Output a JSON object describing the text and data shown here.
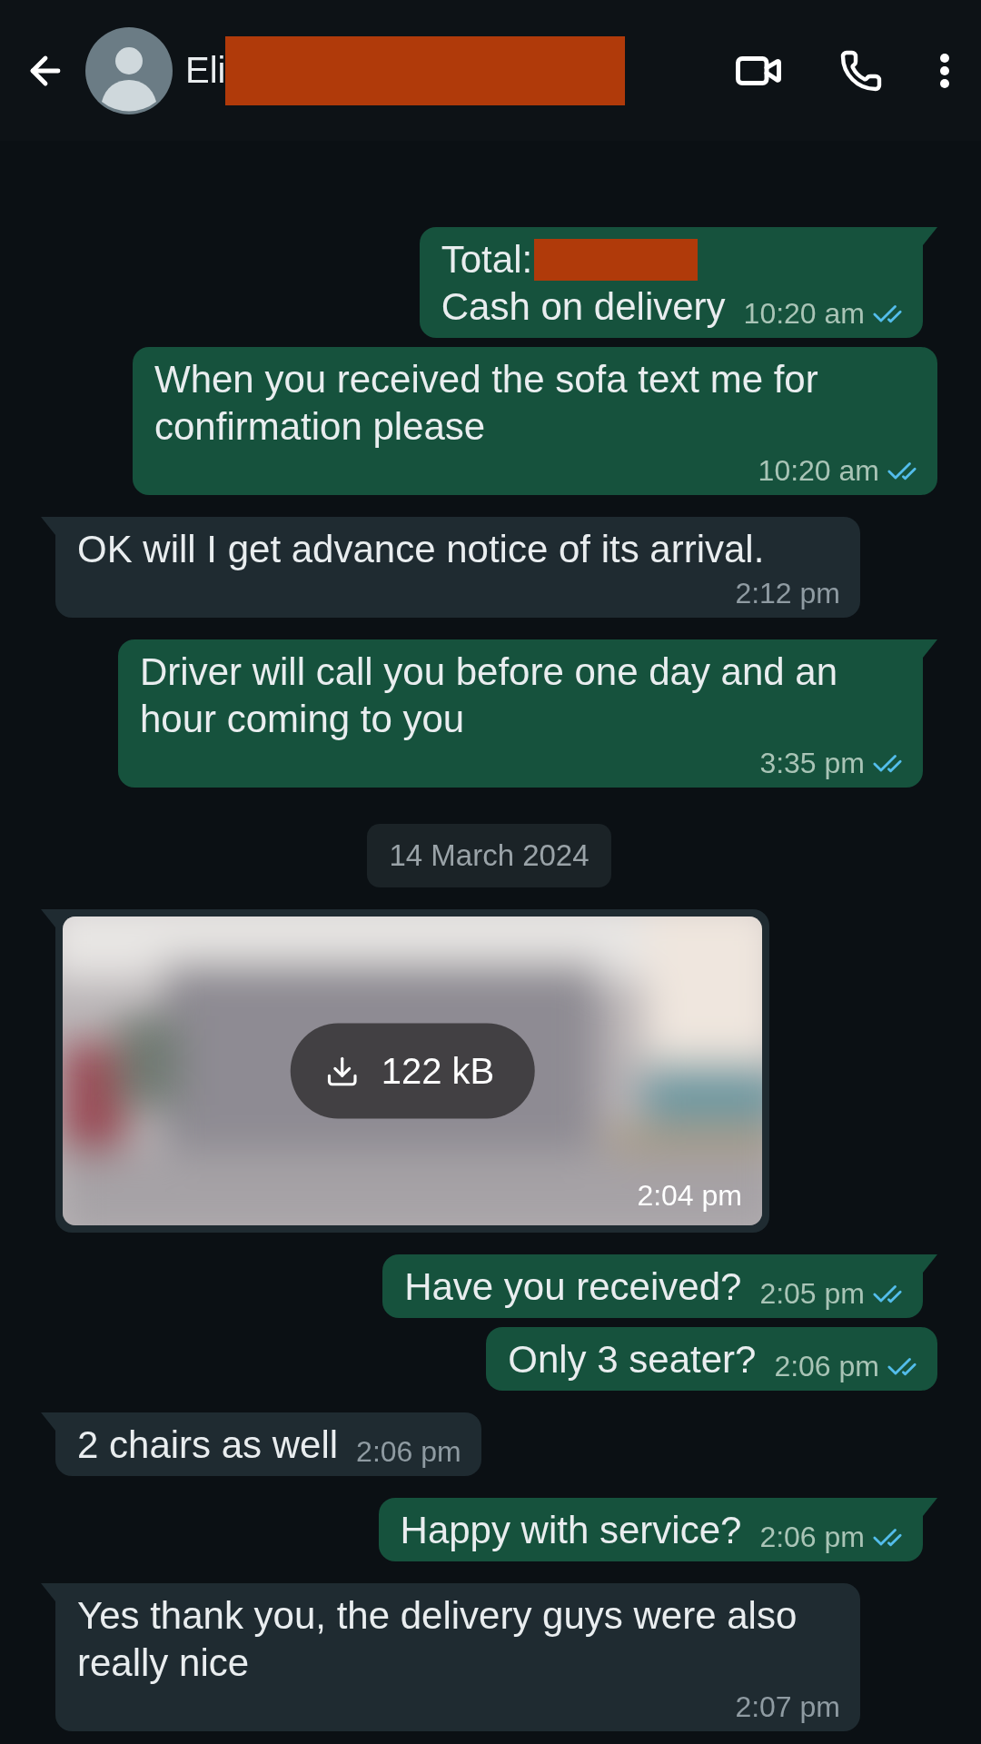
{
  "header": {
    "name": "Eli",
    "name_redacted": true
  },
  "messages": [
    {
      "kind": "text",
      "outgoing": true,
      "lines": [
        {
          "text": "Total:",
          "redacted": true
        },
        {
          "text": "Cash on delivery",
          "redacted": false
        }
      ],
      "time": "10:20 am",
      "read": true
    },
    {
      "kind": "text",
      "outgoing": true,
      "lines": [
        {
          "text": "When you received the sofa text me for confirmation please",
          "redacted": false
        }
      ],
      "time": "10:20 am",
      "read": true
    },
    {
      "kind": "text",
      "outgoing": false,
      "lines": [
        {
          "text": "OK  will I get advance notice of its arrival.",
          "redacted": false
        }
      ],
      "time": "2:12 pm"
    },
    {
      "kind": "text",
      "outgoing": true,
      "lines": [
        {
          "text": "Driver will call you before one day and an hour coming to you",
          "redacted": false
        }
      ],
      "time": "3:35 pm",
      "read": true
    },
    {
      "kind": "date",
      "text": "14 March 2024"
    },
    {
      "outgoing": false,
      "download": "122 kB",
      "time": "2:04 pm"
    },
    {
      "kind": "text",
      "outgoing": true,
      "lines": [
        {
          "text": "Have you received?",
          "redacted": false
        }
      ],
      "time": "2:05 pm",
      "read": true
    },
    {
      "kind": "text",
      "outgoing": true,
      "lines": [
        {
          "text": "Only 3 seater?",
          "redacted": false
        }
      ],
      "time": "2:06 pm",
      "read": true
    },
    {
      "kind": "text",
      "outgoing": false,
      "lines": [
        {
          "text": "2 chairs as well",
          "redacted": false
        }
      ],
      "time": "2:06 pm"
    },
    {
      "kind": "text",
      "outgoing": true,
      "lines": [
        {
          "text": "Happy with service?",
          "redacted": false
        }
      ],
      "time": "2:06 pm",
      "read": true
    },
    {
      "kind": "text",
      "outgoing": false,
      "lines": [
        {
          "text": "Yes thank you, the delivery guys were also really nice",
          "redacted": false
        }
      ],
      "time": "2:07 pm"
    }
  ]
}
